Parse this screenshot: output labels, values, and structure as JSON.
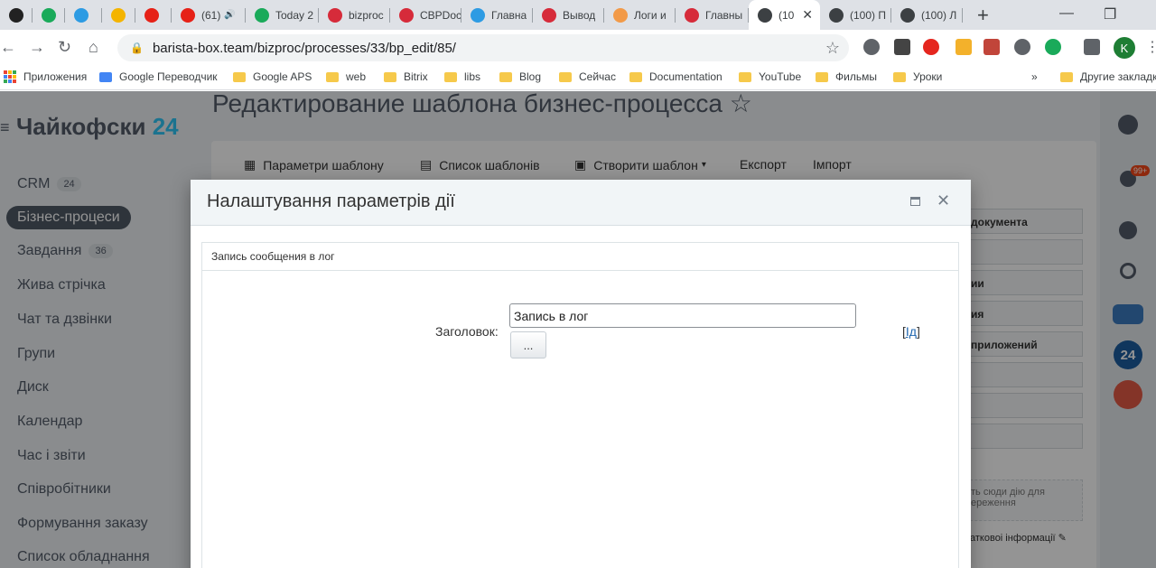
{
  "browser": {
    "tabs": [
      {
        "label": "",
        "icon": "trello-icon",
        "color": "#222"
      },
      {
        "label": "",
        "icon": "check-app-icon",
        "color": "#1aaa5a"
      },
      {
        "label": "",
        "icon": "refresh-app-icon",
        "color": "#2d9be3"
      },
      {
        "label": "",
        "icon": "google-drive-icon",
        "color": "#f4b400"
      },
      {
        "label": "",
        "icon": "youtube-icon",
        "color": "#e62117"
      },
      {
        "label": "(61)",
        "icon": "youtube-icon",
        "color": "#e62117"
      },
      {
        "label": "Today 2",
        "icon": "check-app-icon",
        "color": "#1aaa5a"
      },
      {
        "label": "bizproc",
        "icon": "b-app-icon",
        "color": "#d62b3a"
      },
      {
        "label": "CBPDoc",
        "icon": "b-app-icon",
        "color": "#d62b3a"
      },
      {
        "label": "Главна",
        "icon": "s-app-icon",
        "color": "#2d9be3"
      },
      {
        "label": "Вывод",
        "icon": "b-app-icon",
        "color": "#d62b3a"
      },
      {
        "label": "Логи и",
        "icon": "code-app-icon",
        "color": "#f29a48"
      },
      {
        "label": "Главны",
        "icon": "b-app-icon",
        "color": "#d62b3a"
      },
      {
        "label": "(10",
        "icon": "arrow-circle-icon",
        "color": "#3c4043"
      },
      {
        "label": "(100) П",
        "icon": "arrow-circle-icon",
        "color": "#3c4043"
      },
      {
        "label": "(100) Л",
        "icon": "arrow-circle-icon",
        "color": "#3c4043"
      }
    ],
    "address": "barista-box.team/bizproc/processes/33/bp_edit/85/",
    "profile_letter": "K",
    "bookmarks": [
      {
        "label": "Приложения",
        "type": "apps"
      },
      {
        "label": "Google Переводчик",
        "type": "translate"
      },
      {
        "label": "Google APS",
        "type": "folder"
      },
      {
        "label": "web",
        "type": "folder"
      },
      {
        "label": "Bitrix",
        "type": "folder"
      },
      {
        "label": "libs",
        "type": "folder"
      },
      {
        "label": "Blog",
        "type": "folder"
      },
      {
        "label": "Сейчас",
        "type": "folder"
      },
      {
        "label": "Documentation",
        "type": "folder"
      },
      {
        "label": "YouTube",
        "type": "folder"
      },
      {
        "label": "Фильмы",
        "type": "folder"
      },
      {
        "label": "Уроки",
        "type": "folder"
      }
    ],
    "bookmarks_more": "»",
    "other_bookmarks": "Другие закладки"
  },
  "app": {
    "logo_text": "Чайкофски",
    "logo_num": "24",
    "page_title": "Редактирование шаблона бизнес-процесса",
    "sidebar": [
      {
        "label": "CRM",
        "count": "24"
      },
      {
        "label": "Бізнес-процеси",
        "count": "",
        "active": true
      },
      {
        "label": "Завдання",
        "count": "36"
      },
      {
        "label": "Жива стрічка",
        "count": ""
      },
      {
        "label": "Чат та дзвінки",
        "count": ""
      },
      {
        "label": "Групи",
        "count": ""
      },
      {
        "label": "Диск",
        "count": ""
      },
      {
        "label": "Календар",
        "count": ""
      },
      {
        "label": "Час і звіти",
        "count": ""
      },
      {
        "label": "Співробітники",
        "count": ""
      },
      {
        "label": "Формування заказу",
        "count": ""
      },
      {
        "label": "Список обладнання",
        "count": ""
      }
    ],
    "toolbar": {
      "params": "Параметри шаблону",
      "list": "Список шаблонів",
      "create": "Створити шаблон",
      "export": "Експорт",
      "import": "Імпорт"
    },
    "right_blocks": [
      "документа",
      "",
      "ии",
      "ия",
      "приложений",
      "",
      "",
      ""
    ],
    "drop_hint": "ть сюди дію для\nереження",
    "extra_info": "атковоі інформації",
    "notif_badge": "99+"
  },
  "dialog": {
    "title": "Налаштування параметрів дії",
    "section": "Запись сообщения в лог",
    "field_label": "Заголовок:",
    "field_value": "Запись в лог",
    "ellipsis_button": "...",
    "id_open": "[",
    "id_link": "Ід",
    "id_close": "]"
  }
}
